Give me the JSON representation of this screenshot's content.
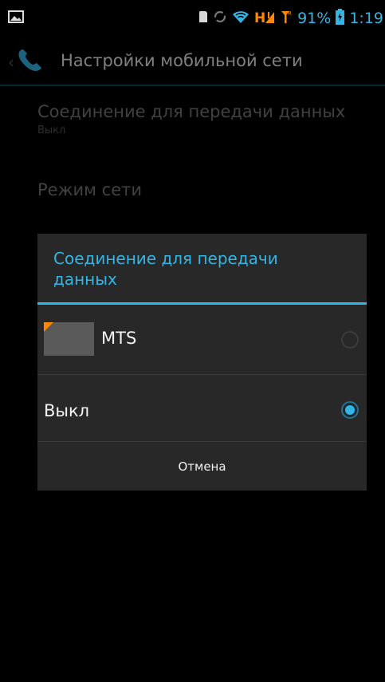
{
  "status_bar": {
    "network_type": "H",
    "battery_percent": "91%",
    "time": "1:19",
    "icons": [
      "picture-icon",
      "sd-card-icon",
      "sync-icon",
      "wifi-icon",
      "h-data-icon",
      "signal-icon",
      "battery-icon"
    ],
    "accent_color": "#33b5e5",
    "network_color": "#ff8800"
  },
  "action_bar": {
    "title": "Настройки мобильной сети",
    "icon": "phone-icon"
  },
  "settings": [
    {
      "title": "Соединение для передачи данных",
      "summary": "Выкл"
    },
    {
      "title": "Режим сети",
      "summary": ""
    }
  ],
  "dialog": {
    "title": "Соединение для передачи данных",
    "options": [
      {
        "label": "MTS",
        "selected": false,
        "icon": "sim-card-icon"
      },
      {
        "label": "Выкл",
        "selected": true
      }
    ],
    "cancel_label": "Отмена"
  }
}
